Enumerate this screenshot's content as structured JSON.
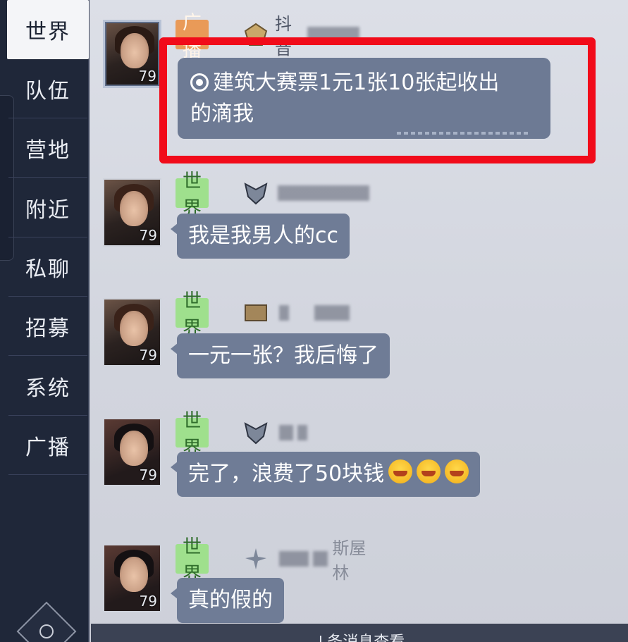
{
  "sidebar": {
    "tabs": [
      {
        "label": "世界",
        "active": true
      },
      {
        "label": "队伍"
      },
      {
        "label": "营地"
      },
      {
        "label": "附近"
      },
      {
        "label": "私聊"
      },
      {
        "label": "招募"
      },
      {
        "label": "系统"
      },
      {
        "label": "广播"
      }
    ]
  },
  "messages": [
    {
      "channel": "广播",
      "username": "抖音",
      "level": "79",
      "text_line1": "建筑大赛票1元1张10张起收出",
      "text_line2": "的滴我"
    },
    {
      "channel": "世界",
      "level": "79",
      "text": "我是我男人的cc"
    },
    {
      "channel": "世界",
      "level": "79",
      "text": "一元一张？我后悔了"
    },
    {
      "channel": "世界",
      "level": "79",
      "text": "完了，浪费了50块钱"
    },
    {
      "channel": "世界",
      "level": "79",
      "text": "真的假的",
      "username_tail": "斯屋林"
    }
  ],
  "bottom_bar": {
    "text": "↓条消息查看"
  },
  "colors": {
    "sidebar_bg": "#1f2739",
    "bubble": "#6f7c96",
    "world_tag": "#9fe08d",
    "broadcast_tag": "#e99a58",
    "highlight": "#f10b1a"
  }
}
